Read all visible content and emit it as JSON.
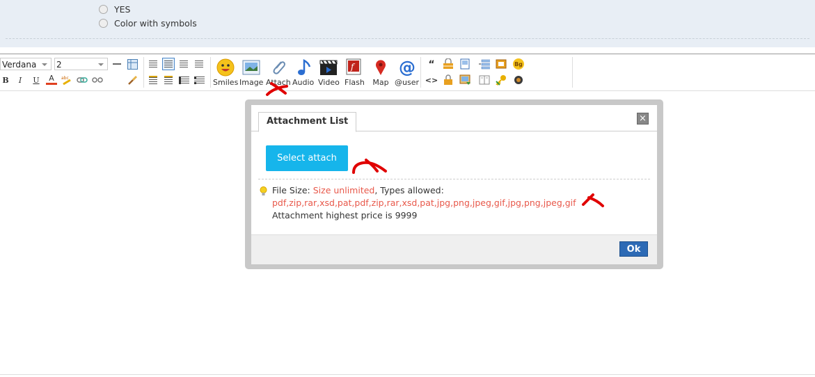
{
  "options": {
    "yes_label": "YES",
    "color_symbols_label": "Color with symbols"
  },
  "toolbar": {
    "font_family": "Verdana",
    "font_size": "2",
    "buttons": {
      "smiles": "Smiles",
      "image": "Image",
      "attach": "Attach",
      "audio": "Audio",
      "video": "Video",
      "flash": "Flash",
      "map": "Map",
      "user": "@user"
    },
    "small": {
      "bold": "B",
      "italic": "I",
      "underline": "U",
      "font_color": "A",
      "quote": "“",
      "code": "<>",
      "bg": "Bg"
    }
  },
  "dialog": {
    "tab_label": "Attachment List",
    "close_symbol": "×",
    "select_button": "Select attach",
    "file_size_prefix": "File Size:",
    "file_size_value": "Size unlimited",
    "types_prefix": ", Types allowed:",
    "types_value": "pdf,zip,rar,xsd,pat,pdf,zip,rar,xsd,pat,jpg,png,jpeg,gif,jpg,png,jpeg,gif",
    "price_text": "Attachment highest price is 9999",
    "ok_label": "Ok"
  },
  "colors": {
    "accent_button": "#16b5eb",
    "ok_button": "#2d6ab5",
    "highlight_text": "#e8584a",
    "annotation_marks": "#e00000"
  }
}
